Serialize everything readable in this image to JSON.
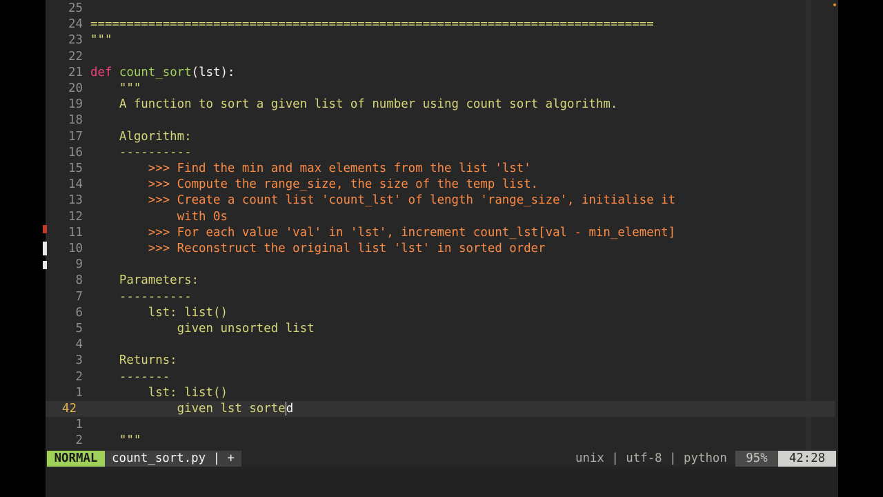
{
  "editor": {
    "lines": [
      {
        "lnr": "25",
        "segments": []
      },
      {
        "lnr": "24",
        "segments": [
          {
            "cls": "c-doc",
            "text": "=============================================================================="
          }
        ]
      },
      {
        "lnr": "23",
        "segments": [
          {
            "cls": "c-doc",
            "text": "\"\"\""
          }
        ]
      },
      {
        "lnr": "22",
        "segments": []
      },
      {
        "lnr": "21",
        "segments": [
          {
            "cls": "c-kw",
            "text": "def"
          },
          {
            "cls": "c-plain",
            "text": " "
          },
          {
            "cls": "c-fn",
            "text": "count_sort"
          },
          {
            "cls": "c-plain",
            "text": "(lst):"
          }
        ]
      },
      {
        "lnr": "20",
        "segments": [
          {
            "cls": "c-doc",
            "text": "    \"\"\""
          }
        ]
      },
      {
        "lnr": "19",
        "segments": [
          {
            "cls": "c-doc",
            "text": "    A function to sort a given list of number using count sort algorithm."
          }
        ]
      },
      {
        "lnr": "18",
        "segments": []
      },
      {
        "lnr": "17",
        "segments": [
          {
            "cls": "c-doc",
            "text": "    Algorithm:"
          }
        ]
      },
      {
        "lnr": "16",
        "segments": [
          {
            "cls": "c-doc",
            "text": "    ----------"
          }
        ]
      },
      {
        "lnr": "15",
        "segments": [
          {
            "cls": "c-doc",
            "text": "        "
          },
          {
            "cls": "c-doctest",
            "text": ">>> Find the min and max elements from the list 'lst'"
          }
        ]
      },
      {
        "lnr": "14",
        "segments": [
          {
            "cls": "c-doc",
            "text": "        "
          },
          {
            "cls": "c-doctest",
            "text": ">>> Compute the range_size, the size of the temp list."
          }
        ]
      },
      {
        "lnr": "13",
        "segments": [
          {
            "cls": "c-doc",
            "text": "        "
          },
          {
            "cls": "c-doctest",
            "text": ">>> Create a count list 'count_lst' of length 'range_size', initialise it"
          }
        ]
      },
      {
        "lnr": "12",
        "segments": [
          {
            "cls": "c-doc",
            "text": "            "
          },
          {
            "cls": "c-doctest",
            "text": "with 0s"
          }
        ]
      },
      {
        "lnr": "11",
        "segments": [
          {
            "cls": "c-doc",
            "text": "        "
          },
          {
            "cls": "c-doctest",
            "text": ">>> For each value 'val' in 'lst', increment count_lst[val - min_element]"
          }
        ]
      },
      {
        "lnr": "10",
        "segments": [
          {
            "cls": "c-doc",
            "text": "        "
          },
          {
            "cls": "c-doctest",
            "text": ">>> Reconstruct the original list 'lst' in sorted order"
          }
        ]
      },
      {
        "lnr": "9",
        "segments": []
      },
      {
        "lnr": "8",
        "segments": [
          {
            "cls": "c-doc",
            "text": "    Parameters:"
          }
        ]
      },
      {
        "lnr": "7",
        "segments": [
          {
            "cls": "c-doc",
            "text": "    ----------"
          }
        ]
      },
      {
        "lnr": "6",
        "segments": [
          {
            "cls": "c-doc",
            "text": "        lst: list()"
          }
        ]
      },
      {
        "lnr": "5",
        "segments": [
          {
            "cls": "c-doc",
            "text": "            given unsorted list"
          }
        ]
      },
      {
        "lnr": "4",
        "segments": []
      },
      {
        "lnr": "3",
        "segments": [
          {
            "cls": "c-doc",
            "text": "    Returns:"
          }
        ]
      },
      {
        "lnr": "2",
        "segments": [
          {
            "cls": "c-doc",
            "text": "    -------"
          }
        ]
      },
      {
        "lnr": "1",
        "segments": [
          {
            "cls": "c-doc",
            "text": "        lst: list()"
          }
        ]
      },
      {
        "lnr": "42",
        "cursorline": true,
        "segments": [
          {
            "cls": "c-doc",
            "text": "            given lst sorte"
          },
          {
            "cls": "c-doc cursor-char",
            "text": "d"
          }
        ]
      },
      {
        "lnr": "1",
        "segments": []
      },
      {
        "lnr": "2",
        "segments": [
          {
            "cls": "c-doc",
            "text": "    \"\"\""
          }
        ]
      }
    ]
  },
  "statusline": {
    "mode": "NORMAL",
    "file": "count_sort.py | +",
    "info": "unix | utf-8 | python",
    "percent": "95%",
    "position": "42:28"
  },
  "colors": {
    "background": "#272727",
    "docstring": "#d7d77a",
    "doctest": "#fc8b46",
    "keyword": "#f0407a",
    "function": "#9fd05a",
    "mode_bg": "#9fd05a",
    "cursor_line_number": "#e5b44d"
  }
}
